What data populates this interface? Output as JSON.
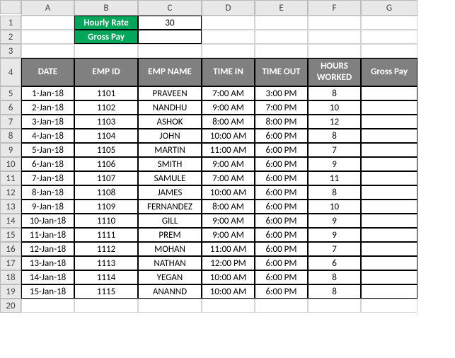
{
  "columns": [
    "A",
    "B",
    "C",
    "D",
    "E",
    "F",
    "G"
  ],
  "top_labels": {
    "hourly_rate": "Hourly Rate",
    "hourly_rate_value": "30",
    "gross_pay": "Gross Pay",
    "gross_pay_value": ""
  },
  "table_headers": {
    "date": "DATE",
    "emp_id": "EMP ID",
    "emp_name": "EMP NAME",
    "time_in": "TIME IN",
    "time_out": "TIME OUT",
    "hours_worked": "HOURS WORKED",
    "gross_pay": "Gross Pay"
  },
  "rows": [
    {
      "date": "1-Jan-18",
      "emp_id": "1101",
      "emp_name": "PRAVEEN",
      "time_in": "7:00 AM",
      "time_out": "3:00 PM",
      "hours_worked": "8",
      "gross_pay": ""
    },
    {
      "date": "2-Jan-18",
      "emp_id": "1102",
      "emp_name": "NANDHU",
      "time_in": "9:00 AM",
      "time_out": "7:00 PM",
      "hours_worked": "10",
      "gross_pay": ""
    },
    {
      "date": "3-Jan-18",
      "emp_id": "1103",
      "emp_name": "ASHOK",
      "time_in": "8:00 AM",
      "time_out": "8:00 PM",
      "hours_worked": "12",
      "gross_pay": ""
    },
    {
      "date": "4-Jan-18",
      "emp_id": "1104",
      "emp_name": "JOHN",
      "time_in": "10:00 AM",
      "time_out": "6:00 PM",
      "hours_worked": "8",
      "gross_pay": ""
    },
    {
      "date": "5-Jan-18",
      "emp_id": "1105",
      "emp_name": "MARTIN",
      "time_in": "11:00 AM",
      "time_out": "6:00 PM",
      "hours_worked": "7",
      "gross_pay": ""
    },
    {
      "date": "6-Jan-18",
      "emp_id": "1106",
      "emp_name": "SMITH",
      "time_in": "9:00 AM",
      "time_out": "6:00 PM",
      "hours_worked": "9",
      "gross_pay": ""
    },
    {
      "date": "7-Jan-18",
      "emp_id": "1107",
      "emp_name": "SAMULE",
      "time_in": "7:00 AM",
      "time_out": "6:00 PM",
      "hours_worked": "11",
      "gross_pay": ""
    },
    {
      "date": "8-Jan-18",
      "emp_id": "1108",
      "emp_name": "JAMES",
      "time_in": "10:00 AM",
      "time_out": "6:00 PM",
      "hours_worked": "8",
      "gross_pay": ""
    },
    {
      "date": "9-Jan-18",
      "emp_id": "1109",
      "emp_name": "FERNANDEZ",
      "time_in": "8:00 AM",
      "time_out": "6:00 PM",
      "hours_worked": "10",
      "gross_pay": ""
    },
    {
      "date": "10-Jan-18",
      "emp_id": "1110",
      "emp_name": "GILL",
      "time_in": "9:00 AM",
      "time_out": "6:00 PM",
      "hours_worked": "9",
      "gross_pay": ""
    },
    {
      "date": "11-Jan-18",
      "emp_id": "1111",
      "emp_name": "PREM",
      "time_in": "9:00 AM",
      "time_out": "6:00 PM",
      "hours_worked": "9",
      "gross_pay": ""
    },
    {
      "date": "12-Jan-18",
      "emp_id": "1112",
      "emp_name": "MOHAN",
      "time_in": "11:00 AM",
      "time_out": "6:00 PM",
      "hours_worked": "7",
      "gross_pay": ""
    },
    {
      "date": "13-Jan-18",
      "emp_id": "1113",
      "emp_name": "NATHAN",
      "time_in": "12:00 PM",
      "time_out": "6:00 PM",
      "hours_worked": "6",
      "gross_pay": ""
    },
    {
      "date": "14-Jan-18",
      "emp_id": "1114",
      "emp_name": "YEGAN",
      "time_in": "10:00 AM",
      "time_out": "6:00 PM",
      "hours_worked": "8",
      "gross_pay": ""
    },
    {
      "date": "15-Jan-18",
      "emp_id": "1115",
      "emp_name": "ANANND",
      "time_in": "10:00 AM",
      "time_out": "6:00 PM",
      "hours_worked": "8",
      "gross_pay": ""
    }
  ],
  "row_numbers": [
    "1",
    "2",
    "3",
    "4",
    "5",
    "6",
    "7",
    "8",
    "9",
    "10",
    "11",
    "12",
    "13",
    "14",
    "15",
    "16",
    "17",
    "18",
    "19",
    "20"
  ]
}
